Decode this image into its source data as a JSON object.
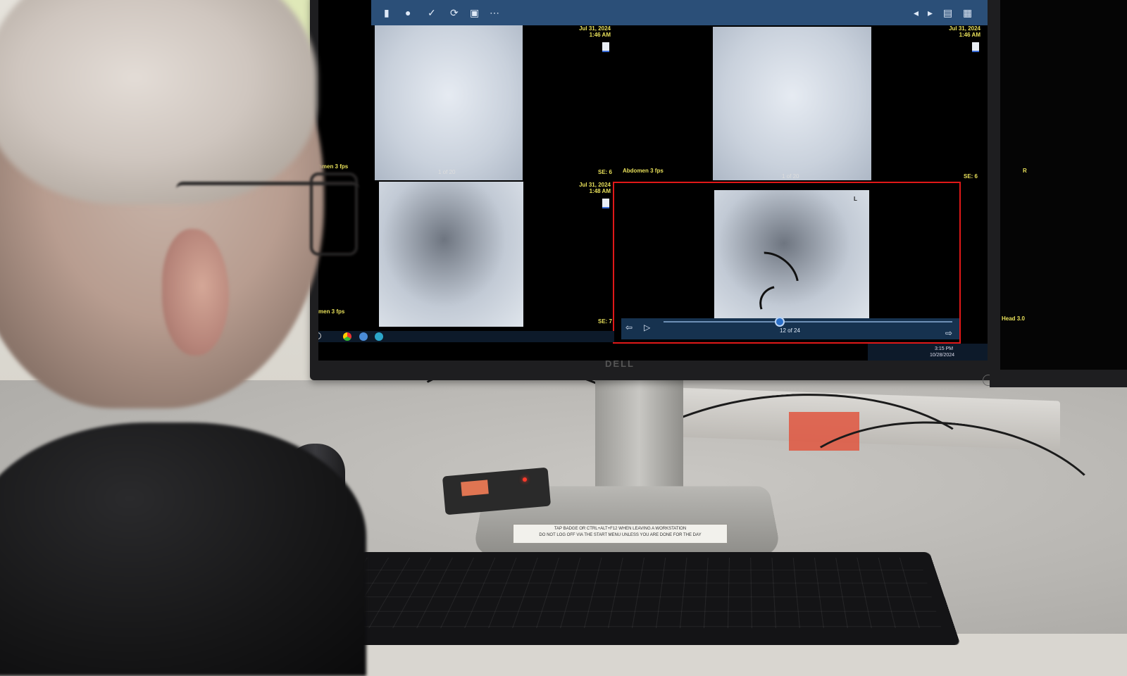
{
  "viewer": {
    "viewports": [
      {
        "date": "Jul 31, 2024",
        "time": "1:46 AM",
        "frame": "1 of 20",
        "series": "SE: 6",
        "protocol": "hmen 3 fps"
      },
      {
        "date": "Jul 31, 2024",
        "time": "1:46 AM",
        "frame": "1 of 20",
        "series": "SE: 6",
        "protocol": "Abdomen 3 fps"
      },
      {
        "date": "Jul 31, 2024",
        "time": "1:48 AM",
        "frame": "",
        "series": "SE: 7",
        "protocol": "men 3 fps"
      },
      {
        "date": "",
        "time": "",
        "frame": "12 of 24",
        "series": "",
        "protocol": "",
        "orientation": "L"
      }
    ],
    "playback": {
      "current_frame": 12,
      "total_frames": 24,
      "label": "12 of 24"
    }
  },
  "taskbar": {
    "time": "3:15 PM",
    "date": "10/28/2024"
  },
  "side_monitor": {
    "protocol": "Head 3.0",
    "orientation": "R"
  },
  "monitor": {
    "brand": "DELL"
  },
  "stand_label": {
    "line1": "TAP BADGE OR CTRL+ALT+F12 WHEN LEAVING A WORKSTATION",
    "line2": "DO NOT LOG OFF VIA THE START MENU UNLESS YOU ARE DONE FOR THE DAY"
  },
  "colors": {
    "selected_border": "#e01818",
    "toolbar": "#2b4f78",
    "overlay_text": "#e8e05a"
  }
}
